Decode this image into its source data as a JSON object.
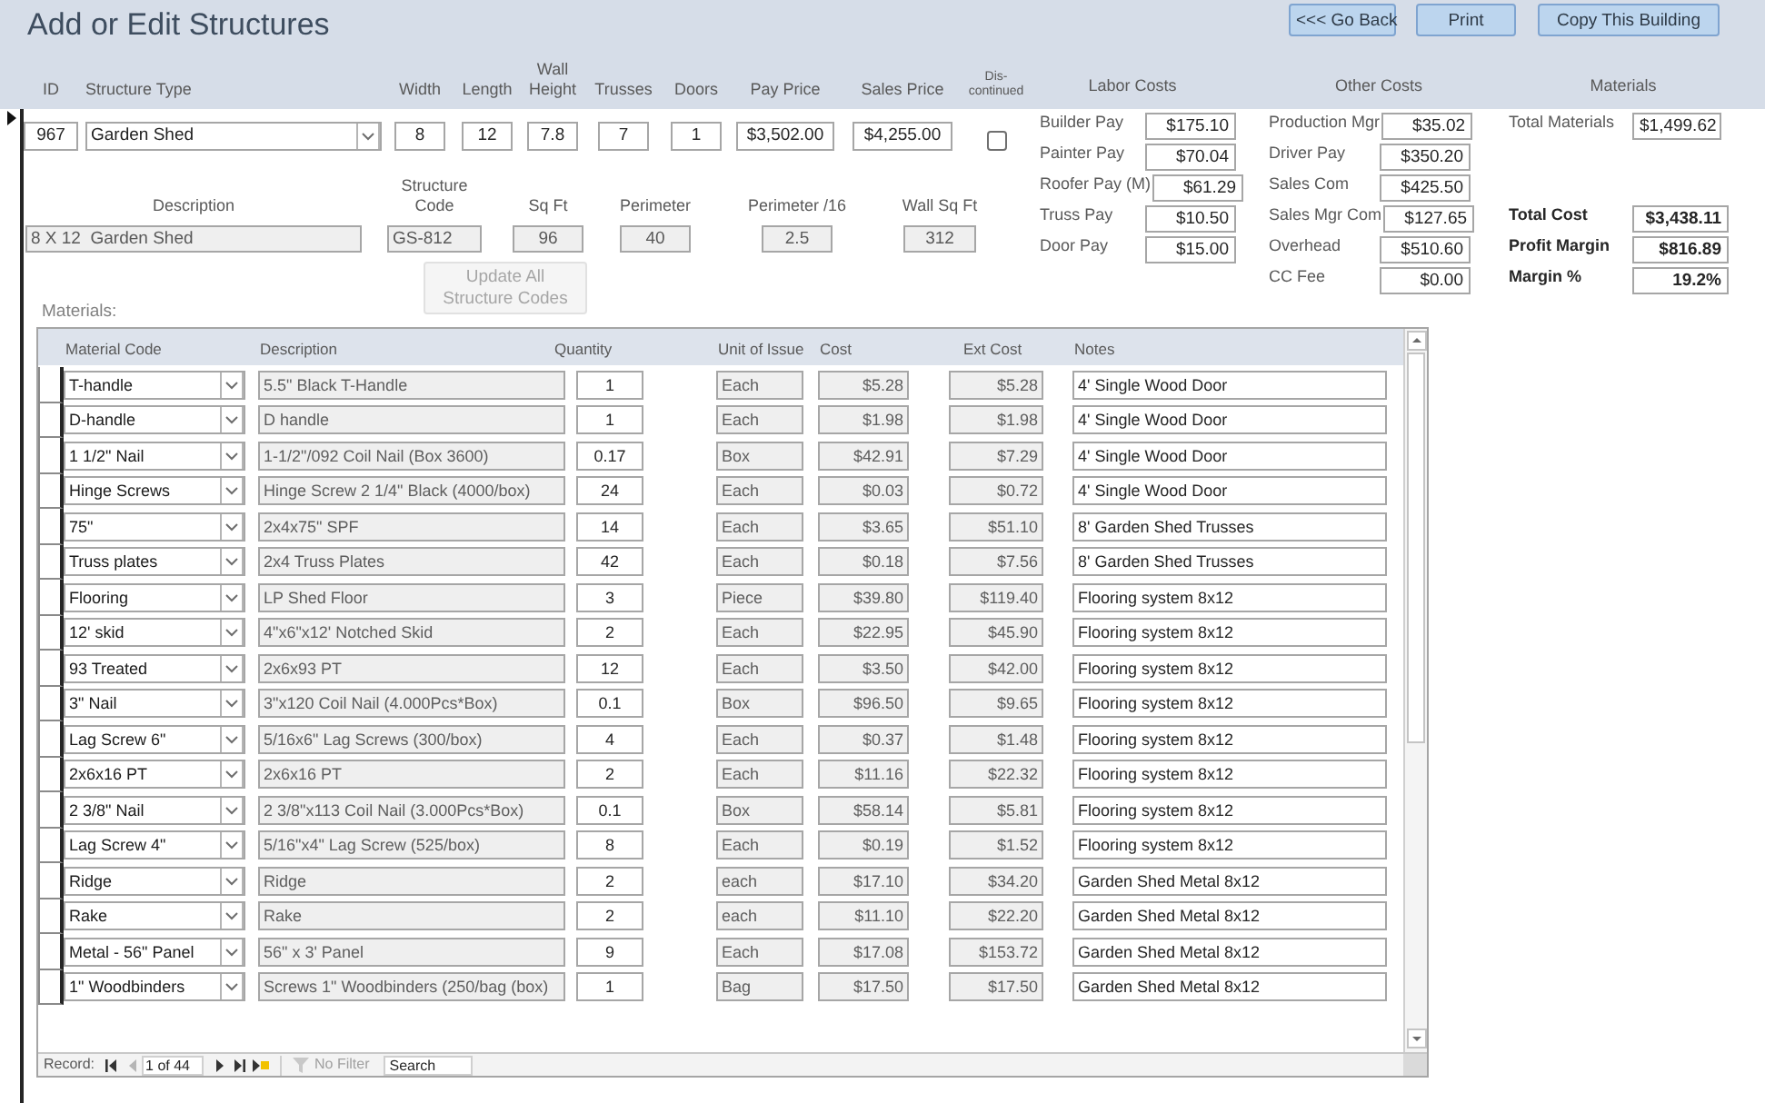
{
  "title": "Add or Edit Structures",
  "buttons": [
    {
      "label": "<<< Go Back"
    },
    {
      "label": "Print"
    },
    {
      "label": "Copy This Building"
    }
  ],
  "main_fields": [
    {
      "kind": "text",
      "label": "ID",
      "value": "967"
    },
    {
      "kind": "combo",
      "label": "Structure Type",
      "value": "Garden Shed"
    },
    {
      "kind": "text",
      "label": "Width",
      "value": "8"
    },
    {
      "kind": "text",
      "label": "Length",
      "value": "12"
    },
    {
      "kind": "text",
      "label": "Wall Height",
      "value": "7.8"
    },
    {
      "kind": "text",
      "label": "Trusses",
      "value": "7"
    },
    {
      "kind": "text",
      "label": "Doors",
      "value": "1"
    },
    {
      "kind": "text",
      "label": "Pay Price",
      "value": "$3,502.00"
    },
    {
      "kind": "text",
      "label": "Sales Price",
      "value": "$4,255.00"
    },
    {
      "kind": "checkbox",
      "label": "Dis-continued",
      "checked": false
    }
  ],
  "computed_fields": [
    {
      "label": "Description",
      "value": "8 X 12  Garden Shed"
    },
    {
      "label": "Structure Code",
      "value": "GS-812"
    },
    {
      "label": "Sq Ft",
      "value": "96"
    },
    {
      "label": "Perimeter",
      "value": "40"
    },
    {
      "label": "Perimeter /16",
      "value": "2.5"
    },
    {
      "label": "Wall Sq Ft",
      "value": "312"
    }
  ],
  "update_button": {
    "label": "Update All Structure Codes",
    "disabled": true
  },
  "labor_costs": {
    "title": "Labor Costs",
    "items": [
      {
        "label": "Builder Pay",
        "value": "$175.10"
      },
      {
        "label": "Painter Pay",
        "value": "$70.04"
      },
      {
        "label": "Roofer Pay (M)",
        "value": "$61.29"
      },
      {
        "label": "Truss Pay",
        "value": "$10.50"
      },
      {
        "label": "Door Pay",
        "value": "$15.00"
      }
    ]
  },
  "other_costs": {
    "title": "Other Costs",
    "items": [
      {
        "label": "Production Mgr",
        "value": "$35.02"
      },
      {
        "label": "Driver Pay",
        "value": "$350.20"
      },
      {
        "label": "Sales Com",
        "value": "$425.50"
      },
      {
        "label": "Sales Mgr Com",
        "value": "$127.65"
      },
      {
        "label": "Overhead",
        "value": "$510.60"
      },
      {
        "label": "CC Fee",
        "value": "$0.00"
      }
    ]
  },
  "materials_summary": {
    "title": "Materials",
    "total_materials": {
      "label": "Total Materials",
      "value": "$1,499.62"
    },
    "totals": [
      {
        "label": "Total Cost",
        "value": "$3,438.11"
      },
      {
        "label": "Profit Margin",
        "value": "$816.89"
      },
      {
        "label": "Margin %",
        "value": "19.2%"
      }
    ]
  },
  "materials_label": "Materials:",
  "materials_table": {
    "columns": [
      "Material Code",
      "Description",
      "Quantity",
      "Unit of Issue",
      "Cost",
      "Ext Cost",
      "Notes"
    ],
    "rows": [
      {
        "code": "T-handle",
        "description": "5.5\" Black T-Handle",
        "quantity": "1",
        "unit": "Each",
        "cost": "$5.28",
        "ext_cost": "$5.28",
        "notes": "4' Single Wood Door"
      },
      {
        "code": "D-handle",
        "description": "D handle",
        "quantity": "1",
        "unit": "Each",
        "cost": "$1.98",
        "ext_cost": "$1.98",
        "notes": "4' Single Wood Door"
      },
      {
        "code": "1 1/2\" Nail",
        "description": "1-1/2\"/092 Coil Nail (Box 3600)",
        "quantity": "0.17",
        "unit": "Box",
        "cost": "$42.91",
        "ext_cost": "$7.29",
        "notes": "4' Single Wood Door"
      },
      {
        "code": "Hinge Screws",
        "description": "Hinge Screw 2 1/4\" Black (4000/box)",
        "quantity": "24",
        "unit": "Each",
        "cost": "$0.03",
        "ext_cost": "$0.72",
        "notes": "4' Single Wood Door"
      },
      {
        "code": "75\"",
        "description": "2x4x75\" SPF",
        "quantity": "14",
        "unit": "Each",
        "cost": "$3.65",
        "ext_cost": "$51.10",
        "notes": "8' Garden Shed Trusses"
      },
      {
        "code": "Truss plates",
        "description": "2x4 Truss Plates",
        "quantity": "42",
        "unit": "Each",
        "cost": "$0.18",
        "ext_cost": "$7.56",
        "notes": "8' Garden Shed Trusses"
      },
      {
        "code": "Flooring",
        "description": "LP Shed Floor",
        "quantity": "3",
        "unit": "Piece",
        "cost": "$39.80",
        "ext_cost": "$119.40",
        "notes": "Flooring system 8x12"
      },
      {
        "code": "12' skid",
        "description": "4\"x6\"x12' Notched Skid",
        "quantity": "2",
        "unit": "Each",
        "cost": "$22.95",
        "ext_cost": "$45.90",
        "notes": "Flooring system 8x12"
      },
      {
        "code": "93 Treated",
        "description": "2x6x93 PT",
        "quantity": "12",
        "unit": "Each",
        "cost": "$3.50",
        "ext_cost": "$42.00",
        "notes": "Flooring system 8x12"
      },
      {
        "code": "3\" Nail",
        "description": "3\"x120 Coil Nail (4.000Pcs*Box)",
        "quantity": "0.1",
        "unit": "Box",
        "cost": "$96.50",
        "ext_cost": "$9.65",
        "notes": "Flooring system 8x12"
      },
      {
        "code": "Lag Screw 6\"",
        "description": "5/16x6\" Lag Screws (300/box)",
        "quantity": "4",
        "unit": "Each",
        "cost": "$0.37",
        "ext_cost": "$1.48",
        "notes": "Flooring system 8x12"
      },
      {
        "code": "2x6x16 PT",
        "description": "2x6x16 PT",
        "quantity": "2",
        "unit": "Each",
        "cost": "$11.16",
        "ext_cost": "$22.32",
        "notes": "Flooring system 8x12"
      },
      {
        "code": "2 3/8\" Nail",
        "description": "2 3/8\"x113 Coil Nail (3.000Pcs*Box)",
        "quantity": "0.1",
        "unit": "Box",
        "cost": "$58.14",
        "ext_cost": "$5.81",
        "notes": "Flooring system 8x12"
      },
      {
        "code": "Lag Screw 4\"",
        "description": "5/16\"x4\" Lag Screw (525/box)",
        "quantity": "8",
        "unit": "Each",
        "cost": "$0.19",
        "ext_cost": "$1.52",
        "notes": "Flooring system 8x12"
      },
      {
        "code": "Ridge",
        "description": "Ridge",
        "quantity": "2",
        "unit": "each",
        "cost": "$17.10",
        "ext_cost": "$34.20",
        "notes": "Garden Shed Metal 8x12"
      },
      {
        "code": "Rake",
        "description": "Rake",
        "quantity": "2",
        "unit": "each",
        "cost": "$11.10",
        "ext_cost": "$22.20",
        "notes": "Garden Shed Metal 8x12"
      },
      {
        "code": "Metal - 56\" Panel",
        "description": "56\" x 3' Panel",
        "quantity": "9",
        "unit": "Each",
        "cost": "$17.08",
        "ext_cost": "$153.72",
        "notes": "Garden Shed Metal 8x12"
      },
      {
        "code": "1\" Woodbinders",
        "description": "Screws 1\" Woodbinders (250/bag (box)",
        "quantity": "1",
        "unit": "Bag",
        "cost": "$17.50",
        "ext_cost": "$17.50",
        "notes": "Garden Shed Metal 8x12"
      }
    ]
  },
  "record_nav": {
    "label": "Record:",
    "position": "1 of 44",
    "filter": "No Filter",
    "search": {
      "placeholder": "Search"
    }
  }
}
